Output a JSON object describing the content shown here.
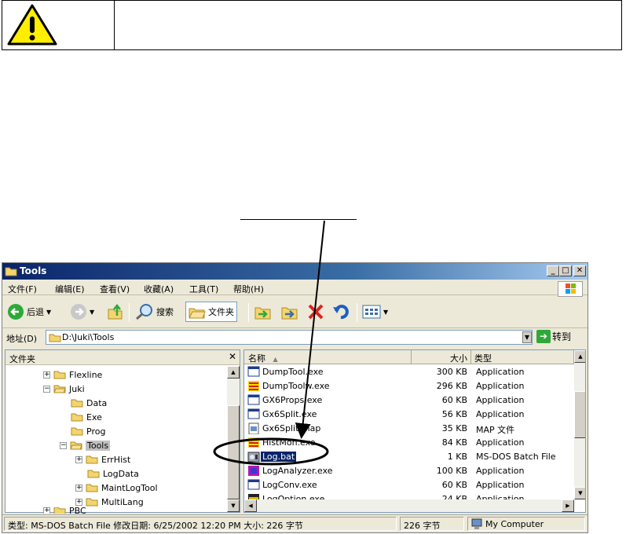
{
  "window": {
    "title": "Tools",
    "menu": [
      "文件(F)",
      "编辑(E)",
      "查看(V)",
      "收藏(A)",
      "工具(T)",
      "帮助(H)"
    ],
    "toolbar": {
      "back": "后退",
      "search": "搜索",
      "folders": "文件夹"
    },
    "address": {
      "label": "地址(D)",
      "value": "D:\\Juki\\Tools",
      "go": "转到"
    },
    "folders_pane": {
      "title": "文件夹",
      "close": "✕",
      "items": [
        {
          "label": "Flexline",
          "expander": "+"
        },
        {
          "label": "Juki",
          "expander": "−"
        },
        {
          "label": "Data",
          "expander": ""
        },
        {
          "label": "Exe",
          "expander": ""
        },
        {
          "label": "Prog",
          "expander": ""
        },
        {
          "label": "Tools",
          "expander": "−"
        },
        {
          "label": "ErrHist",
          "expander": "+"
        },
        {
          "label": "LogData",
          "expander": ""
        },
        {
          "label": "MaintLogTool",
          "expander": "+"
        },
        {
          "label": "MultiLang",
          "expander": "+"
        },
        {
          "label": "PBC",
          "expander": "+"
        }
      ]
    },
    "columns": {
      "name": "名称",
      "size": "大小",
      "type": "类型"
    },
    "files": [
      {
        "name": "DumpTool.exe",
        "size": "300 KB",
        "type": "Application",
        "icon": "app-window-icon"
      },
      {
        "name": "DumpToolw.exe",
        "size": "296 KB",
        "type": "Application",
        "icon": "colorful-tool-icon"
      },
      {
        "name": "GX6Props.exe",
        "size": "60 KB",
        "type": "Application",
        "icon": "app-window-icon"
      },
      {
        "name": "Gx6Split.exe",
        "size": "56 KB",
        "type": "Application",
        "icon": "app-window-icon"
      },
      {
        "name": "Gx6Split.map",
        "size": "35 KB",
        "type": "MAP 文件",
        "icon": "map-file-icon"
      },
      {
        "name": "HistMon.exe",
        "size": "84 KB",
        "type": "Application",
        "icon": "colorful-tool-icon"
      },
      {
        "name": "Log.bat",
        "size": "1 KB",
        "type": "MS-DOS Batch File",
        "icon": "batch-file-icon"
      },
      {
        "name": "LogAnalyzer.exe",
        "size": "100 KB",
        "type": "Application",
        "icon": "purple-app-icon"
      },
      {
        "name": "LogConv.exe",
        "size": "60 KB",
        "type": "Application",
        "icon": "app-window-icon"
      },
      {
        "name": "LogOption.exe",
        "size": "24 KB",
        "type": "Application",
        "icon": "log-app-icon"
      }
    ],
    "status": {
      "info": "类型: MS-DOS Batch File 修改日期: 6/25/2002 12:20 PM 大小: 226 字节",
      "bytes": "226 字节",
      "zone": "My Computer"
    }
  },
  "colors": {
    "selection": "#0a246a",
    "titlebar": "#0a246a",
    "warning_yellow": "#ffee00"
  }
}
